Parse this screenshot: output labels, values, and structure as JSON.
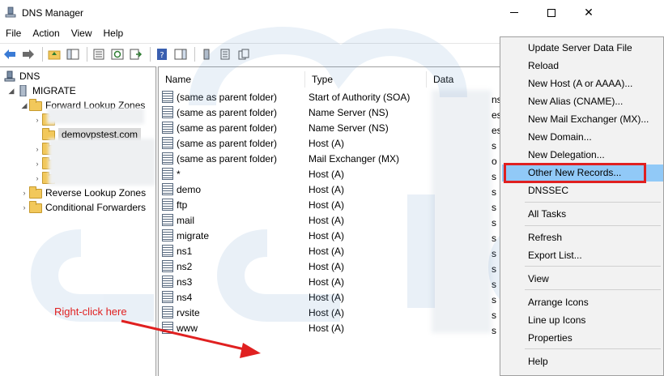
{
  "window": {
    "title": "DNS Manager"
  },
  "menubar": {
    "items": [
      "File",
      "Action",
      "View",
      "Help"
    ]
  },
  "tree": {
    "root": "DNS",
    "server": "MIGRATE",
    "forward_zones": "Forward Lookup Zones",
    "selected_zone": "demovpstest.com",
    "reverse_zones": "Reverse Lookup Zones",
    "conditional_forwarders": "Conditional Forwarders"
  },
  "list": {
    "columns": [
      "Name",
      "Type",
      "Data"
    ],
    "records": [
      {
        "name": "(same as parent folder)",
        "type": "Start of Authority (SOA)",
        "data_edge": "ns"
      },
      {
        "name": "(same as parent folder)",
        "type": "Name Server (NS)",
        "data_edge": "es"
      },
      {
        "name": "(same as parent folder)",
        "type": "Name Server (NS)",
        "data_edge": "es"
      },
      {
        "name": "(same as parent folder)",
        "type": "Host (A)",
        "data_edge": "s"
      },
      {
        "name": "(same as parent folder)",
        "type": "Mail Exchanger (MX)",
        "data_edge": "o"
      },
      {
        "name": "*",
        "type": "Host (A)",
        "data_edge": "s"
      },
      {
        "name": "demo",
        "type": "Host (A)",
        "data_edge": "s"
      },
      {
        "name": "ftp",
        "type": "Host (A)",
        "data_edge": "s"
      },
      {
        "name": "mail",
        "type": "Host (A)",
        "data_edge": "s"
      },
      {
        "name": "migrate",
        "type": "Host (A)",
        "data_edge": "s"
      },
      {
        "name": "ns1",
        "type": "Host (A)",
        "data_edge": "s"
      },
      {
        "name": "ns2",
        "type": "Host (A)",
        "data_edge": "s"
      },
      {
        "name": "ns3",
        "type": "Host (A)",
        "data_edge": "s"
      },
      {
        "name": "ns4",
        "type": "Host (A)",
        "data_edge": "s"
      },
      {
        "name": "rvsite",
        "type": "Host (A)",
        "data_edge": "s"
      },
      {
        "name": "www",
        "type": "Host (A)",
        "data_edge": "s"
      }
    ]
  },
  "context_menu": {
    "items": [
      "Update Server Data File",
      "Reload",
      "New Host (A or AAAA)...",
      "New Alias (CNAME)...",
      "New Mail Exchanger (MX)...",
      "New Domain...",
      "New Delegation...",
      "Other New Records...",
      "DNSSEC",
      "All Tasks",
      "Refresh",
      "Export List...",
      "View",
      "Arrange Icons",
      "Line up Icons",
      "Properties",
      "Help"
    ],
    "highlighted": "Other New Records..."
  },
  "annotation": {
    "text": "Right-click here"
  },
  "colors": {
    "highlight_red": "#e02020",
    "menu_hover": "#91c9f7",
    "watermark": "#5b8fc7"
  }
}
